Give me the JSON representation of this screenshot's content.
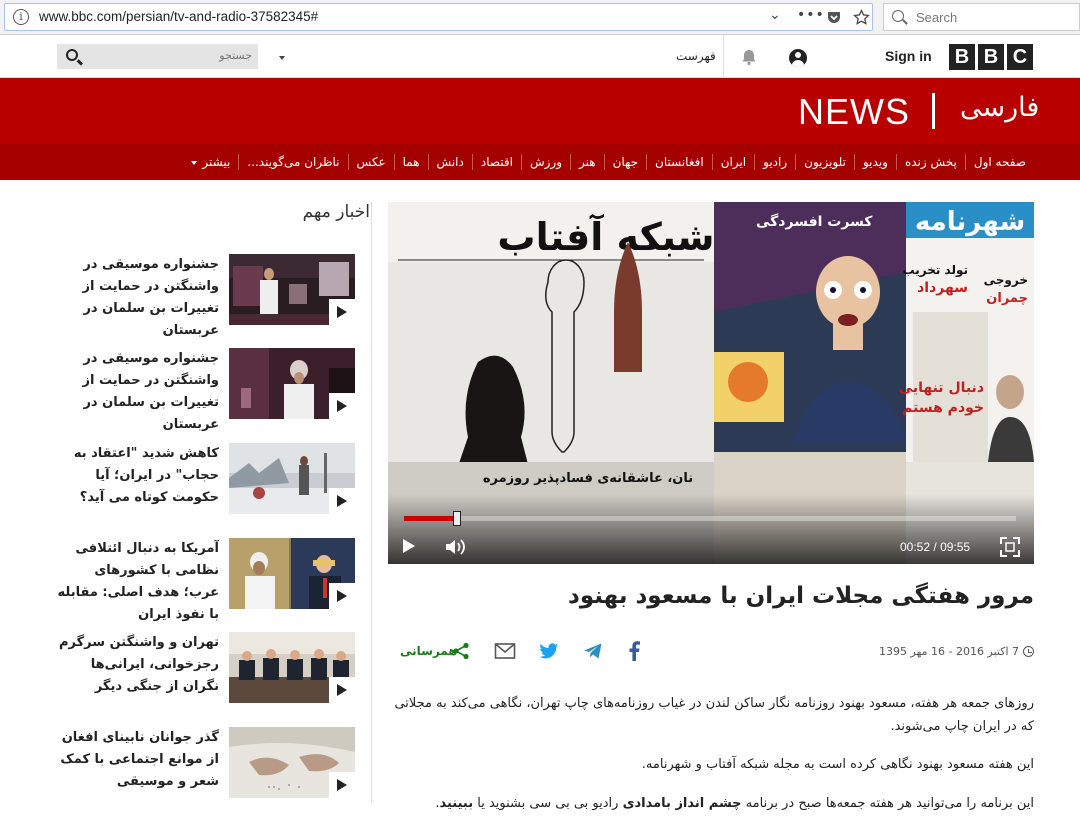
{
  "browser": {
    "url": "www.bbc.com/persian/tv-and-radio-37582345#",
    "search_placeholder": "Search"
  },
  "topbar": {
    "logo_letters": [
      "B",
      "B",
      "C"
    ],
    "sign_in": "Sign in",
    "menu_label": "فهرست",
    "search_placeholder": "جستجو"
  },
  "masthead": {
    "news": "NEWS",
    "language": "فارسی"
  },
  "nav": {
    "items": [
      "صفحه اول",
      "پخش زنده",
      "ویدیو",
      "تلویزیون",
      "رادیو",
      "ایران",
      "افغانستان",
      "جهان",
      "هنر",
      "ورزش",
      "اقتصاد",
      "دانش",
      "هما",
      "عکس",
      "ناظران می‌گویند...",
      "بیشتر"
    ]
  },
  "sidebar": {
    "title": "اخبار مهم",
    "stories": [
      {
        "text": "جشنواره موسیقی در واشنگتن در حمایت از تغییرات بن سلمان در عربستان"
      },
      {
        "text": "جشنواره موسیقی در واشنگتن در حمایت از تغییرات بن سلمان در عربستان"
      },
      {
        "text": "کاهش شدید \"اعتقاد به حجاب\" در ایران؛ آیا حکومت کوتاه می آید؟"
      },
      {
        "text": "آمریکا به دنبال ائتلافی نظامی با کشورهای عرب؛ هدف اصلی: مقابله با نفوذ ایران"
      },
      {
        "text": "تهران و واشنگتن سرگرم رجزخوانی، ایرانی‌ها نگران از جنگی دیگر"
      },
      {
        "text": "گذر جوانان نابینای افغان از موانع اجتماعی با کمک شعر و موسیقی"
      }
    ]
  },
  "video": {
    "current_time": "00:52",
    "separator": "/",
    "duration": "09:55",
    "progress_fraction": 0.0873,
    "magazines": {
      "left_title": "شبکه آفتاب",
      "left_caption": "نان، عاشقانه‌ی فسادپذیر روزمره",
      "middle_title": "کسرت افسردگی",
      "right_title": "شهرنامه",
      "right_headline1": "تولد تخریب",
      "right_headline2": "سهرداد",
      "right_headline3": "خروجی",
      "right_headline4": "چمران",
      "right_headline5": "دنبال تنهایی",
      "right_headline6": "خودم هستم"
    }
  },
  "article": {
    "headline": "مرور هفتگی مجلات ایران با مسعود بهنود",
    "date": "7 اکتبر 2016 - 16 مهر 1395",
    "share_label": "همرسانی",
    "p1": "روزهای جمعه هر هفته، مسعود بهنود روزنامه نگار ساکن لندن در غیاب روزنامه‌های چاپ تهران، نگاهی می‌کند به مجلاتی که در ایران چاپ می‌شوند.",
    "p2": "این هفته مسعود بهنود نگاهی کرده است به مجله شبکه آفتاب و شهرنامه.",
    "p3_before": "این برنامه را می‌توانید هر هفته جمعه‌ها صبح در برنامه ",
    "p3_bold": "چشم انداز بامدادی",
    "p3_mid": " رادیو بی بی سی بشنوید یا ",
    "p3_link": "ببینید",
    "p3_end": "."
  },
  "colors": {
    "brand_red": "#b80000",
    "nav_red": "#a40000",
    "share_green": "#1a7b1a"
  }
}
